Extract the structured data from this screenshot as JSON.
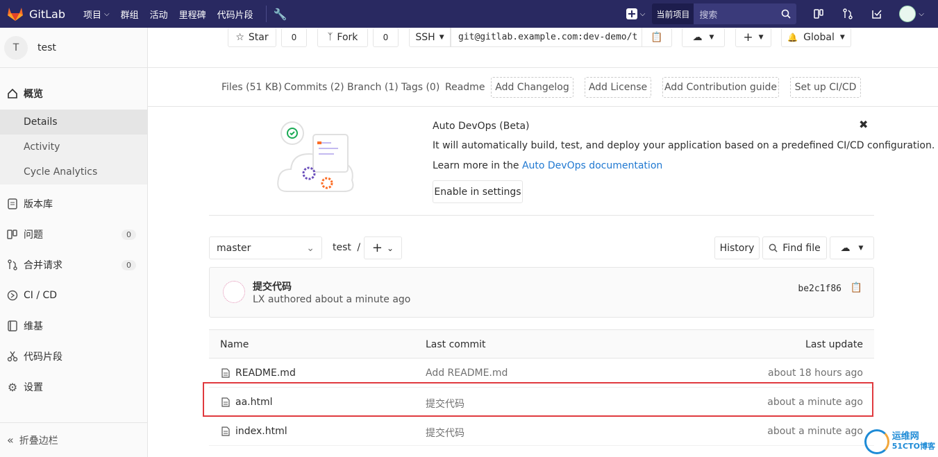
{
  "topbar": {
    "brand": "GitLab",
    "nav": [
      "项目",
      "群组",
      "活动",
      "里程碑",
      "代码片段"
    ],
    "scope": "当前项目",
    "search_placeholder": "搜索"
  },
  "sidebar": {
    "project_initial": "T",
    "project_name": "test",
    "overview": "概览",
    "sub": [
      "Details",
      "Activity",
      "Cycle Analytics"
    ],
    "items": [
      {
        "label": "版本库"
      },
      {
        "label": "问题",
        "count": "0"
      },
      {
        "label": "合并请求",
        "count": "0"
      },
      {
        "label": "CI / CD"
      },
      {
        "label": "维基"
      },
      {
        "label": "代码片段"
      },
      {
        "label": "设置"
      }
    ],
    "collapse": "折叠边栏"
  },
  "project_bar": {
    "star": "Star",
    "star_count": "0",
    "fork": "Fork",
    "fork_count": "0",
    "protocol": "SSH",
    "clone_url": "git@gitlab.example.com:dev-demo/t",
    "notification": "Global"
  },
  "stats": {
    "files": "Files (51 KB)",
    "commits": "Commits (2)",
    "branch": "Branch (1)",
    "tags": "Tags (0)",
    "readme": "Readme",
    "add_changelog": "Add Changelog",
    "add_license": "Add License",
    "add_contribution": "Add Contribution guide",
    "setup_ci": "Set up CI/CD"
  },
  "banner": {
    "title": "Auto DevOps (Beta)",
    "text": "It will automatically build, test, and deploy your application based on a predefined CI/CD configuration.",
    "learn_prefix": "Learn more in the ",
    "learn_link": "Auto DevOps documentation",
    "enable_button": "Enable in settings"
  },
  "tree": {
    "branch": "master",
    "path": "test",
    "path_sep": "/",
    "history": "History",
    "find_file": "Find file"
  },
  "last_commit": {
    "message": "提交代码",
    "author_line": "LX authored about a minute ago",
    "sha": "be2c1f86"
  },
  "files": {
    "headers": {
      "name": "Name",
      "commit": "Last commit",
      "update": "Last update"
    },
    "rows": [
      {
        "name": "README.md",
        "commit": "Add README.md",
        "update": "about 18 hours ago"
      },
      {
        "name": "aa.html",
        "commit": "提交代码",
        "update": "about a minute ago"
      },
      {
        "name": "index.html",
        "commit": "提交代码",
        "update": "about a minute ago"
      }
    ]
  },
  "watermark": {
    "line1": "运维网",
    "line2": "51CTO博客"
  },
  "colors": {
    "topbar": "#292961",
    "link": "#1f78d1",
    "highlight": "#e0393e"
  }
}
